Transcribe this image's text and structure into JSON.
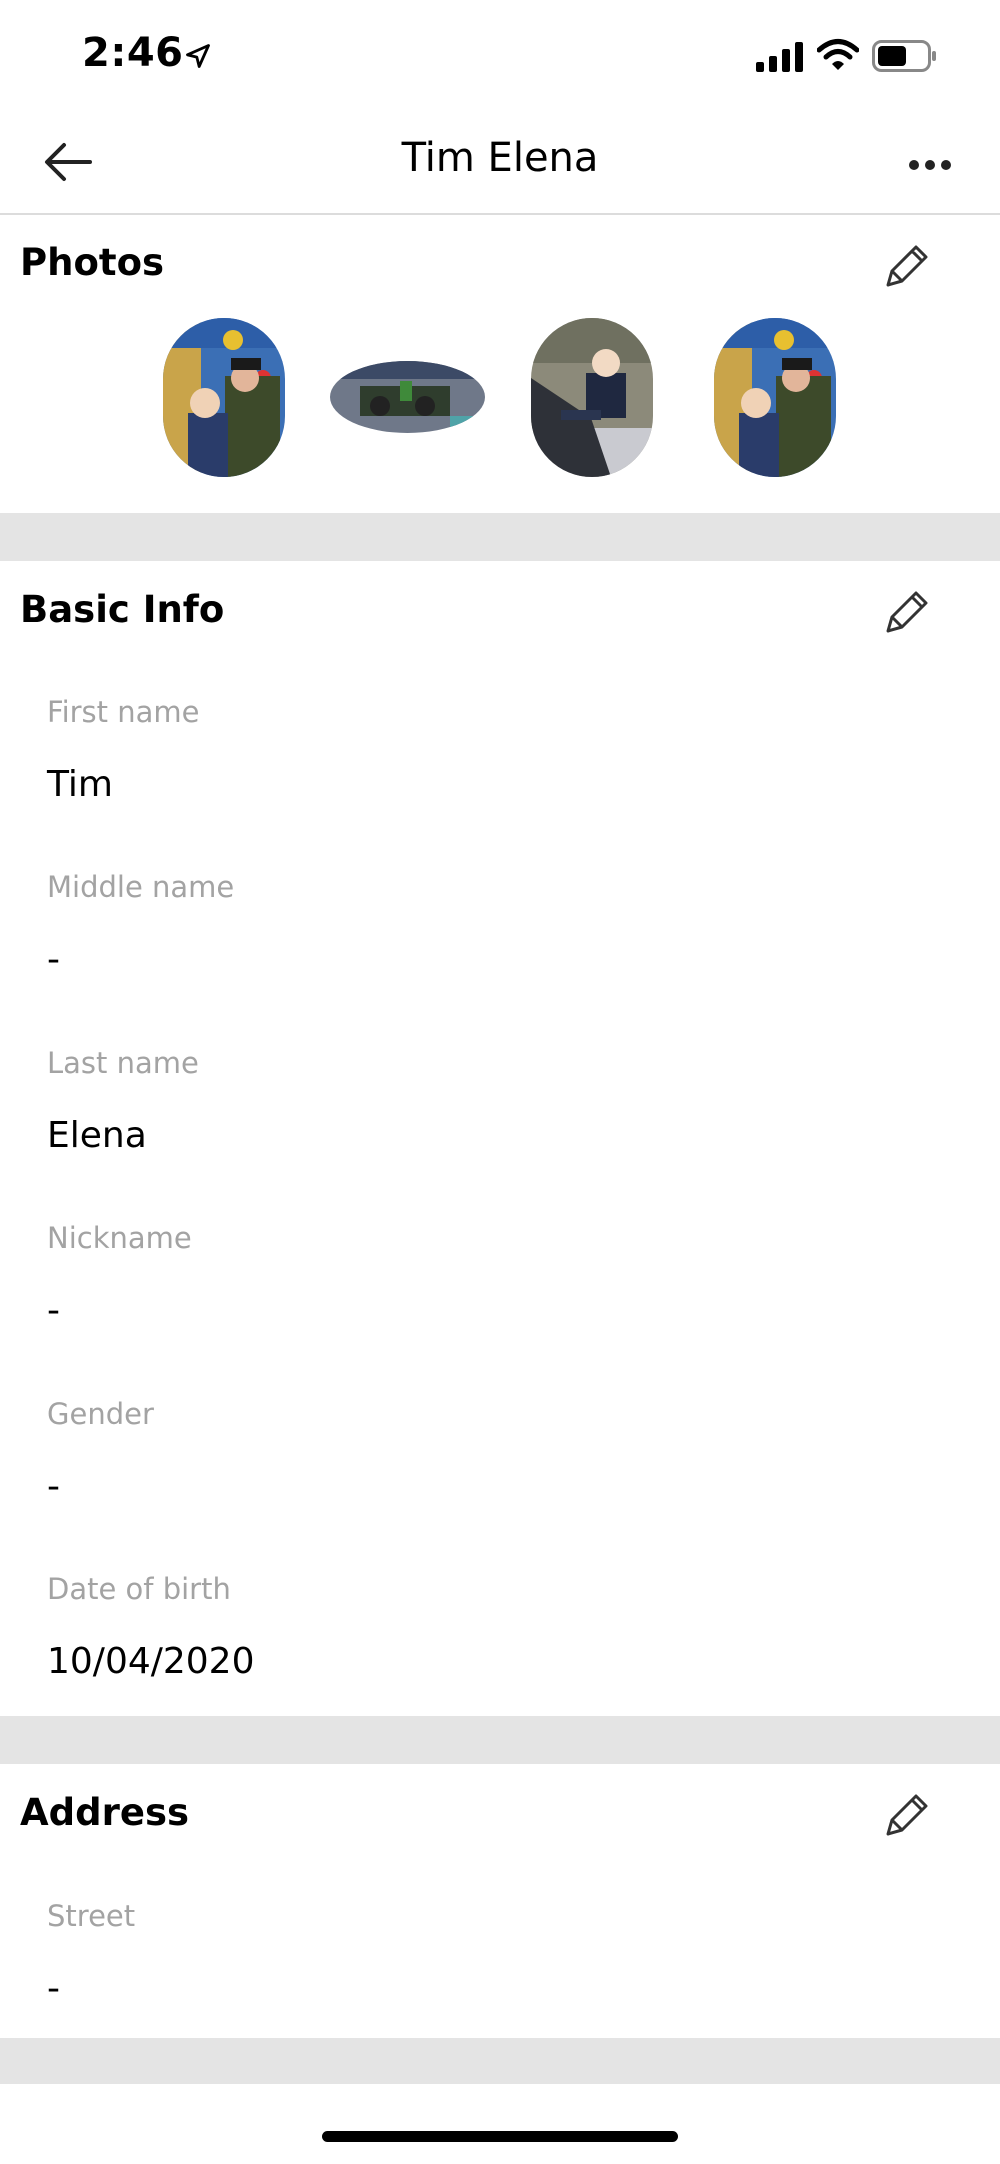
{
  "status_bar": {
    "time": "2:46"
  },
  "header": {
    "title": "Tim Elena"
  },
  "photos_section": {
    "title": "Photos",
    "photos": [
      "photo-1",
      "photo-2",
      "photo-3",
      "photo-4"
    ]
  },
  "basic_info": {
    "title": "Basic Info",
    "fields": [
      {
        "label": "First name",
        "value": "Tim"
      },
      {
        "label": "Middle name",
        "value": "-"
      },
      {
        "label": "Last name",
        "value": "Elena"
      },
      {
        "label": "Nickname",
        "value": "-"
      },
      {
        "label": "Gender",
        "value": "-"
      },
      {
        "label": "Date of birth",
        "value": "10/04/2020"
      }
    ]
  },
  "address": {
    "title": "Address",
    "fields": [
      {
        "label": "Street",
        "value": "-"
      }
    ]
  },
  "icons": {
    "back": "arrow-left-icon",
    "more": "more-horizontal-icon",
    "edit": "pencil-icon"
  }
}
